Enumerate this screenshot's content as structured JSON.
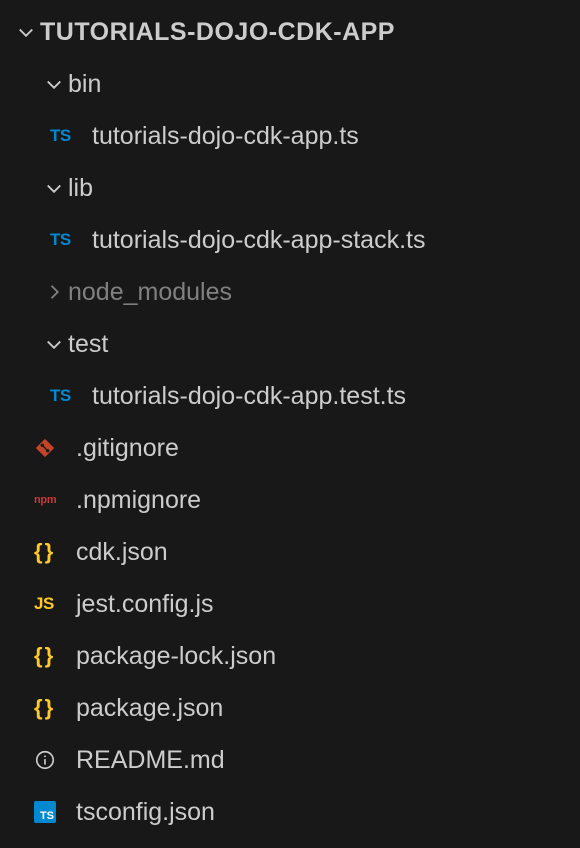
{
  "root": {
    "name": "TUTORIALS-DOJO-CDK-APP"
  },
  "folders": {
    "bin": {
      "name": "bin",
      "expanded": true
    },
    "lib": {
      "name": "lib",
      "expanded": true
    },
    "node_modules": {
      "name": "node_modules",
      "expanded": false
    },
    "test": {
      "name": "test",
      "expanded": true
    }
  },
  "files": {
    "bin_app": "tutorials-dojo-cdk-app.ts",
    "lib_stack": "tutorials-dojo-cdk-app-stack.ts",
    "test_app": "tutorials-dojo-cdk-app.test.ts",
    "gitignore": ".gitignore",
    "npmignore": ".npmignore",
    "cdk_json": "cdk.json",
    "jest_config": "jest.config.js",
    "package_lock": "package-lock.json",
    "package_json": "package.json",
    "readme": "README.md",
    "tsconfig": "tsconfig.json"
  },
  "icons": {
    "ts": "TS",
    "js": "JS",
    "json": "{ }",
    "npm": "npm",
    "ts_box": "TS"
  }
}
